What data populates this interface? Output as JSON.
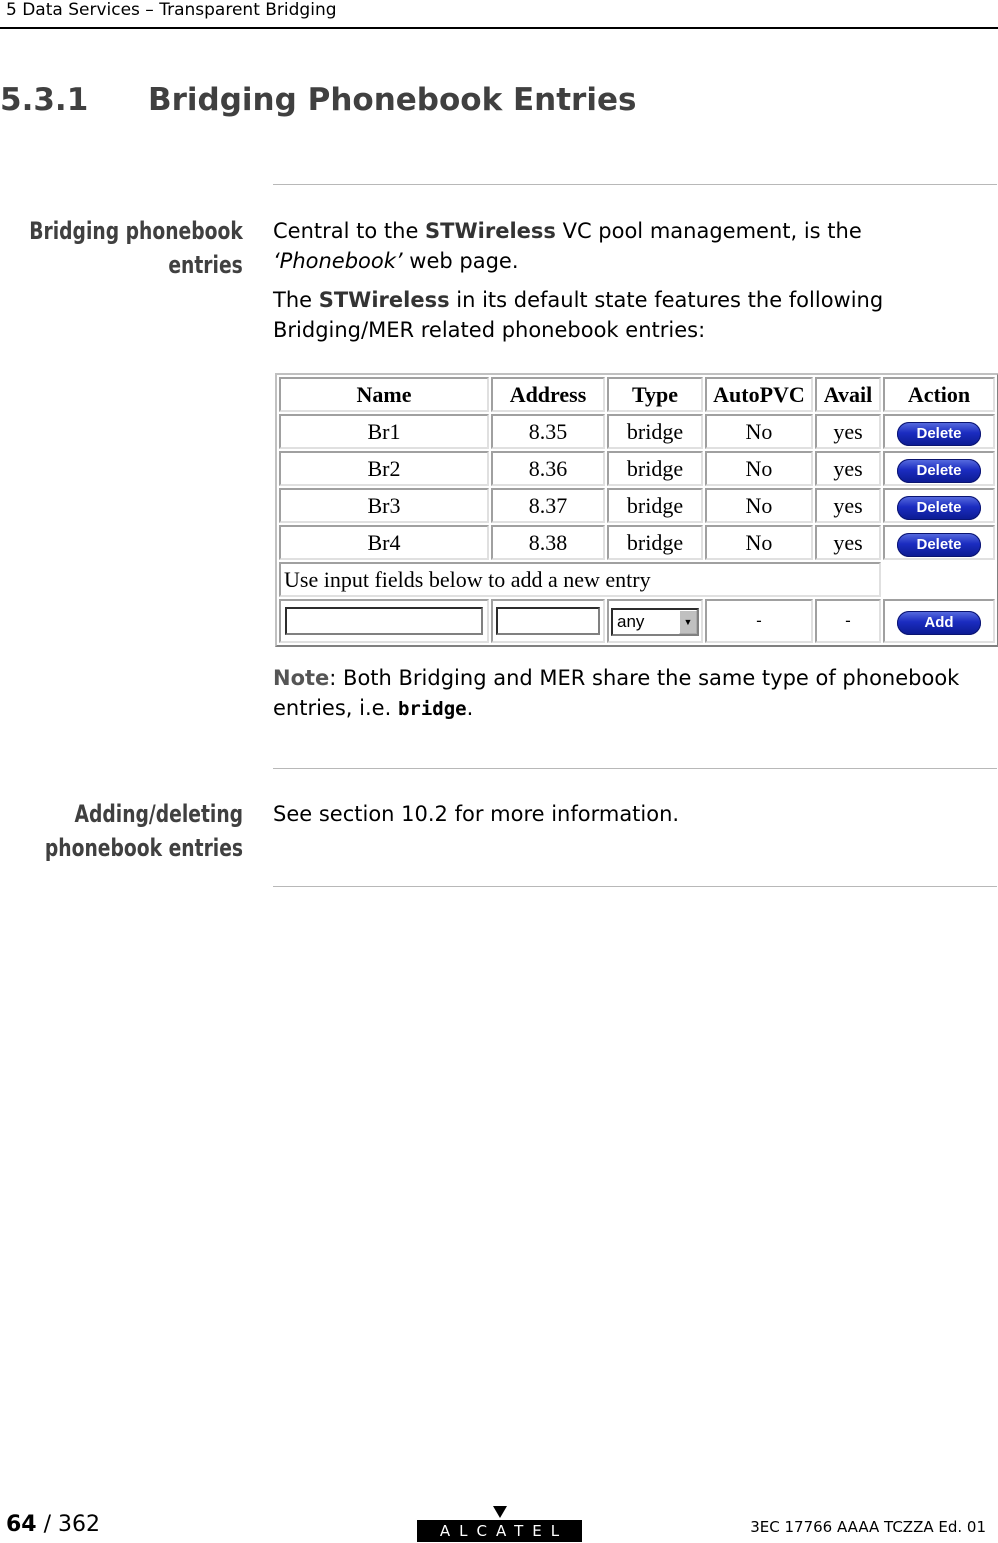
{
  "header": {
    "running_title": "5   Data Services – Transparent Bridging"
  },
  "section": {
    "number": "5.3.1",
    "title": "Bridging Phonebook Entries"
  },
  "block1": {
    "side_heading_line1": "Bridging phonebook",
    "side_heading_line2": "entries",
    "p1_pre": "Central to the ",
    "p1_brand": "STWireless",
    "p1_mid": " VC pool management, is the ",
    "p1_italic": "‘Phonebook’",
    "p1_post": " web page.",
    "p2_pre": "The ",
    "p2_brand": "STWireless",
    "p2_post": " in its default state features the following Bridging/MER related phonebook entries:",
    "note_label": "Note",
    "note_text": ": Both Bridging and MER share the same type of phonebook entries, i.e. ",
    "note_code": "bridge",
    "note_end": "."
  },
  "phonebook_table": {
    "columns": [
      "Name",
      "Address",
      "Type",
      "AutoPVC",
      "Avail",
      "Action"
    ],
    "rows": [
      {
        "name": "Br1",
        "address": "8.35",
        "type": "bridge",
        "autopvc": "No",
        "avail": "yes",
        "action": "Delete"
      },
      {
        "name": "Br2",
        "address": "8.36",
        "type": "bridge",
        "autopvc": "No",
        "avail": "yes",
        "action": "Delete"
      },
      {
        "name": "Br3",
        "address": "8.37",
        "type": "bridge",
        "autopvc": "No",
        "avail": "yes",
        "action": "Delete"
      },
      {
        "name": "Br4",
        "address": "8.38",
        "type": "bridge",
        "autopvc": "No",
        "avail": "yes",
        "action": "Delete"
      }
    ],
    "add_hint": "Use input fields below to add a new entry",
    "new_entry": {
      "name_value": "",
      "address_value": "",
      "type_selected": "any",
      "autopvc": "-",
      "avail": "-",
      "add_label": "Add"
    }
  },
  "block2": {
    "side_heading_line1": "Adding/deleting",
    "side_heading_line2": "phonebook entries",
    "text": "See section 10.2 for more information."
  },
  "footer": {
    "page_current": "64",
    "page_total": " / 362",
    "logo_text": "ALCATEL",
    "doc_ref": "3EC 17766 AAAA TCZZA Ed. 01"
  }
}
